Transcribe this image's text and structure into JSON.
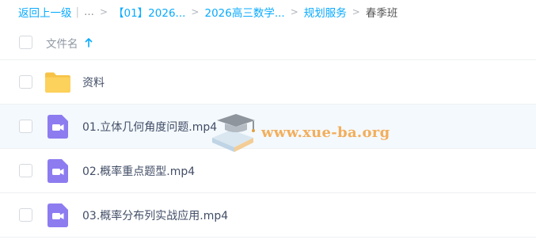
{
  "breadcrumb": {
    "back": "返回上一级",
    "ellipsis": "...",
    "items": [
      "【01】2026...",
      "2026高三数学...",
      "规划服务"
    ],
    "current": "春季班"
  },
  "table": {
    "header": {
      "name_label": "文件名"
    },
    "rows": [
      {
        "name": "资料",
        "type": "folder"
      },
      {
        "name": "01.立体几何角度问题.mp4",
        "type": "video"
      },
      {
        "name": "02.概率重点题型.mp4",
        "type": "video"
      },
      {
        "name": "03.概率分布列实战应用.mp4",
        "type": "video"
      }
    ]
  },
  "watermark": {
    "text": "www.xue-ba.org"
  },
  "colors": {
    "accent": "#09aaff",
    "folder": "#fcd15c",
    "video": "#8c7cf0",
    "watermark": "#f3a23f"
  },
  "icons": {
    "sort": "arrow-up-icon",
    "folder": "folder-icon",
    "video": "video-file-icon",
    "watermark": "graduation-cap-book-icon"
  }
}
